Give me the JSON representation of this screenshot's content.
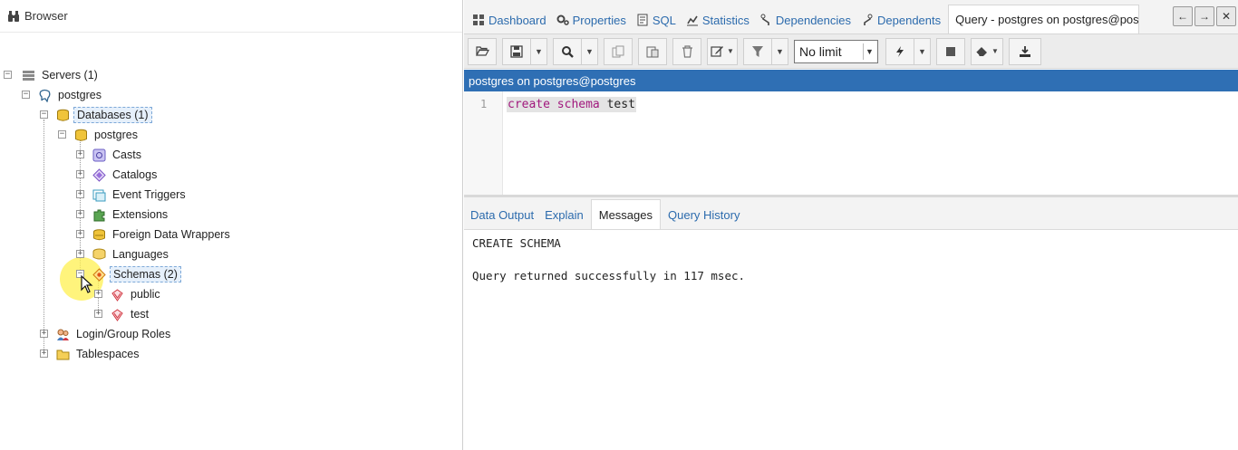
{
  "browser": {
    "title": "Browser",
    "tree": {
      "servers": "Servers (1)",
      "server": "postgres",
      "databases": "Databases (1)",
      "database": "postgres",
      "casts": "Casts",
      "catalogs": "Catalogs",
      "event_triggers": "Event Triggers",
      "extensions": "Extensions",
      "fdw": "Foreign Data Wrappers",
      "languages": "Languages",
      "schemas": "Schemas (2)",
      "schema_public": "public",
      "schema_test": "test",
      "login_roles": "Login/Group Roles",
      "tablespaces": "Tablespaces"
    }
  },
  "tabs": [
    {
      "label": "Dashboard",
      "icon": "dashboard-icon"
    },
    {
      "label": "Properties",
      "icon": "gears-icon"
    },
    {
      "label": "SQL",
      "icon": "sql-icon"
    },
    {
      "label": "Statistics",
      "icon": "chart-icon"
    },
    {
      "label": "Dependencies",
      "icon": "dependencies-icon"
    },
    {
      "label": "Dependents",
      "icon": "dependents-icon"
    },
    {
      "label": "Query - postgres on postgres@postgres",
      "icon": "bolt-icon"
    }
  ],
  "toolbar": {
    "limit": "No limit"
  },
  "connection": "postgres on postgres@postgres",
  "editor": {
    "line_number": "1",
    "kw1": "create",
    "kw2": "schema",
    "ident": "test"
  },
  "result_tabs": [
    "Data Output",
    "Explain",
    "Messages",
    "Query History"
  ],
  "messages": {
    "line1": "CREATE SCHEMA",
    "line2": "Query returned successfully in 117 msec."
  },
  "colors": {
    "accent": "#2f6fb4",
    "link": "#2c6bad",
    "keyword": "#a1187d"
  }
}
